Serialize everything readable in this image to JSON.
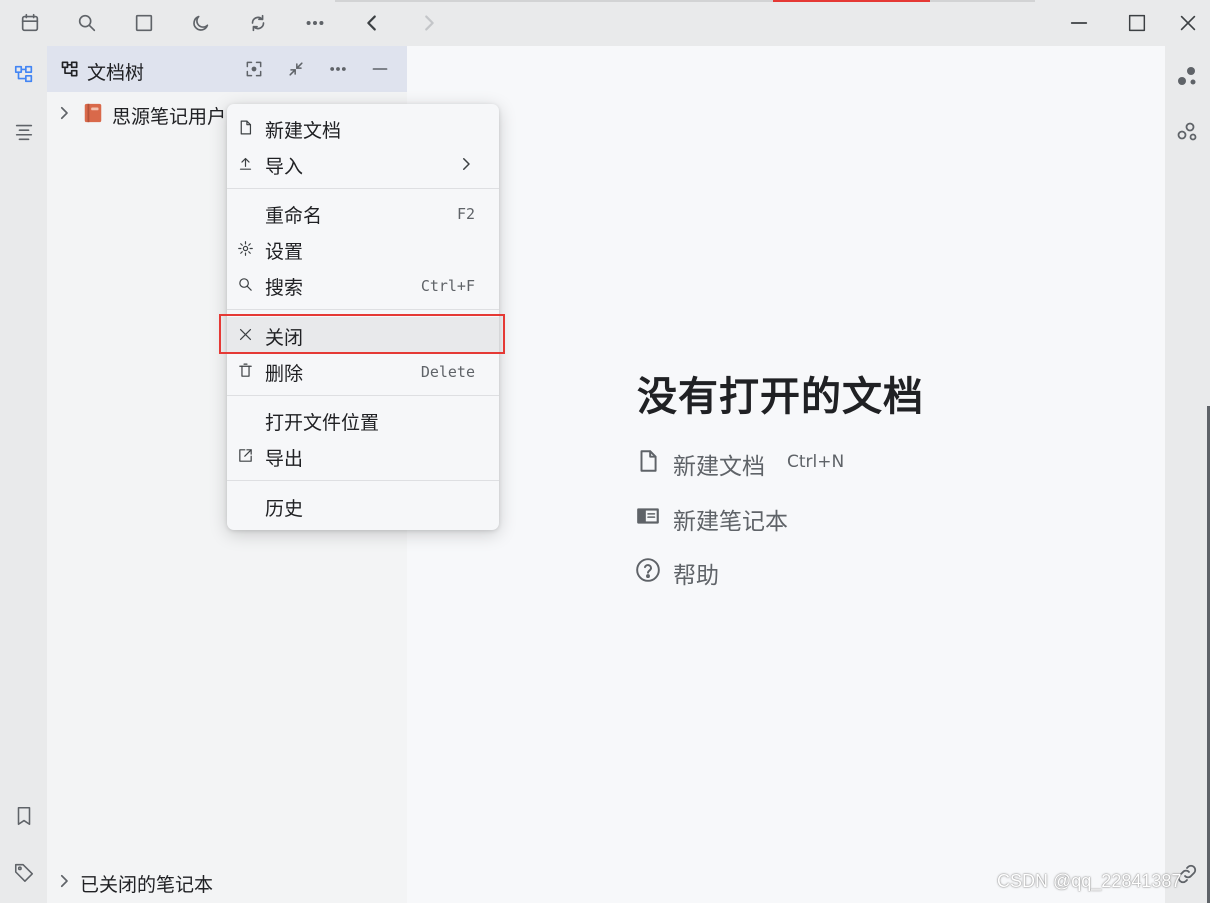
{
  "toolbar": {
    "icons": [
      "calendar-icon",
      "search-icon",
      "square-icon",
      "moon-icon",
      "sync-icon",
      "more-icon",
      "back-icon",
      "forward-icon"
    ],
    "window_controls": [
      "minimize-icon",
      "maximize-icon",
      "close-icon"
    ]
  },
  "tree": {
    "title": "文档树",
    "notebook_label": "思源笔记用户",
    "closed_notebooks_label": "已关闭的笔记本"
  },
  "context_menu": {
    "items": [
      {
        "label": "新建文档",
        "icon": "file-icon"
      },
      {
        "label": "导入",
        "icon": "upload-icon",
        "has_submenu": true
      },
      {
        "label": "重命名",
        "shortcut": "F2"
      },
      {
        "label": "设置",
        "icon": "gear-icon"
      },
      {
        "label": "搜索",
        "icon": "search-icon",
        "shortcut": "Ctrl+F"
      },
      {
        "label": "关闭",
        "icon": "close-icon"
      },
      {
        "label": "删除",
        "icon": "trash-icon",
        "shortcut": "Delete"
      },
      {
        "label": "打开文件位置"
      },
      {
        "label": "导出",
        "icon": "external-icon"
      },
      {
        "label": "历史"
      }
    ]
  },
  "main": {
    "empty_title": "没有打开的文档",
    "actions": [
      {
        "label": "新建文档",
        "hint": "Ctrl+N",
        "icon": "file-icon"
      },
      {
        "label": "新建笔记本",
        "icon": "notebook-icon"
      },
      {
        "label": "帮助",
        "icon": "help-icon"
      }
    ]
  },
  "watermark": "CSDN @qq_22841387",
  "colors": {
    "accent": "#4285f4",
    "highlight_border": "#e53935",
    "notebook_icon": "#d9694a"
  }
}
